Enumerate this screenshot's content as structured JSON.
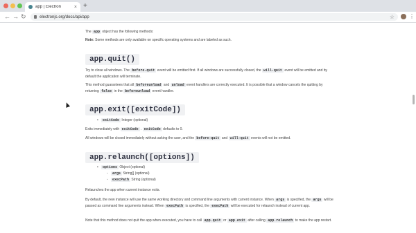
{
  "browser": {
    "tab_title": "app | Electron",
    "tab_close": "×",
    "new_tab": "+",
    "back": "←",
    "forward": "→",
    "reload": "↻",
    "url": "electronjs.org/docs/api/app",
    "star": "☆",
    "menu": "⋮"
  },
  "doc": {
    "intro_pre": "The",
    "intro_code": "app",
    "intro_post": "object has the following methods:",
    "note_label": "Note:",
    "note_text": "Some methods are only available on specific operating systems and are labeled as such.",
    "quit": {
      "heading": "app.quit()",
      "p1_a": "Try to close all windows. The",
      "p1_code1": "before-quit",
      "p1_b": "event will be emitted first. If all windows are successfully closed, the",
      "p1_code2": "will-quit",
      "p1_c": "event will be emitted and by default the application will terminate.",
      "p2_a": "This method guarantees that all",
      "p2_code1": "beforeunload",
      "p2_b": "and",
      "p2_code2": "unload",
      "p2_c": "event handlers are correctly executed. It is possible that a window cancels the quitting by returning",
      "p2_code3": "false",
      "p2_d": "in the",
      "p2_code4": "beforeunload",
      "p2_e": "event handler."
    },
    "exit": {
      "heading": "app.exit([exitCode])",
      "param_code": "exitCode",
      "param_type": "Integer (optional)",
      "p1_a": "Exits immediately with",
      "p1_code1": "exitCode",
      "p1_code2": "exitCode",
      "p1_b": "defaults to 0.",
      "p2_a": "All windows will be closed immediately without asking the user, and the",
      "p2_code1": "before-quit",
      "p2_b": "and",
      "p2_code2": "will-quit",
      "p2_c": "events will not be emitted."
    },
    "relaunch": {
      "heading": "app.relaunch([options])",
      "options_code": "options",
      "options_type": "Object (optional)",
      "args_code": "args",
      "args_type": "String[] (optional)",
      "execpath_code": "execPath",
      "execpath_type": "String (optional)",
      "p1": "Relaunches the app when current instance exits.",
      "p2_a": "By default, the new instance will use the same working directory and command line arguments with current instance. When",
      "p2_code1": "args",
      "p2_b": "is specified, the",
      "p2_code2": "args",
      "p2_c": "will be passed as command line arguments instead. When",
      "p2_code3": "execPath",
      "p2_d": "is specified, the",
      "p2_code4": "execPath",
      "p2_e": "will be executed for relaunch instead of current app.",
      "p3_a": "Note that this method does not quit the app when executed, you have to call",
      "p3_code1": "app.quit",
      "p3_b": "or",
      "p3_code2": "app.exit",
      "p3_c": "after calling",
      "p3_code3": "app.relaunch",
      "p3_d": "to make the app restart."
    }
  }
}
